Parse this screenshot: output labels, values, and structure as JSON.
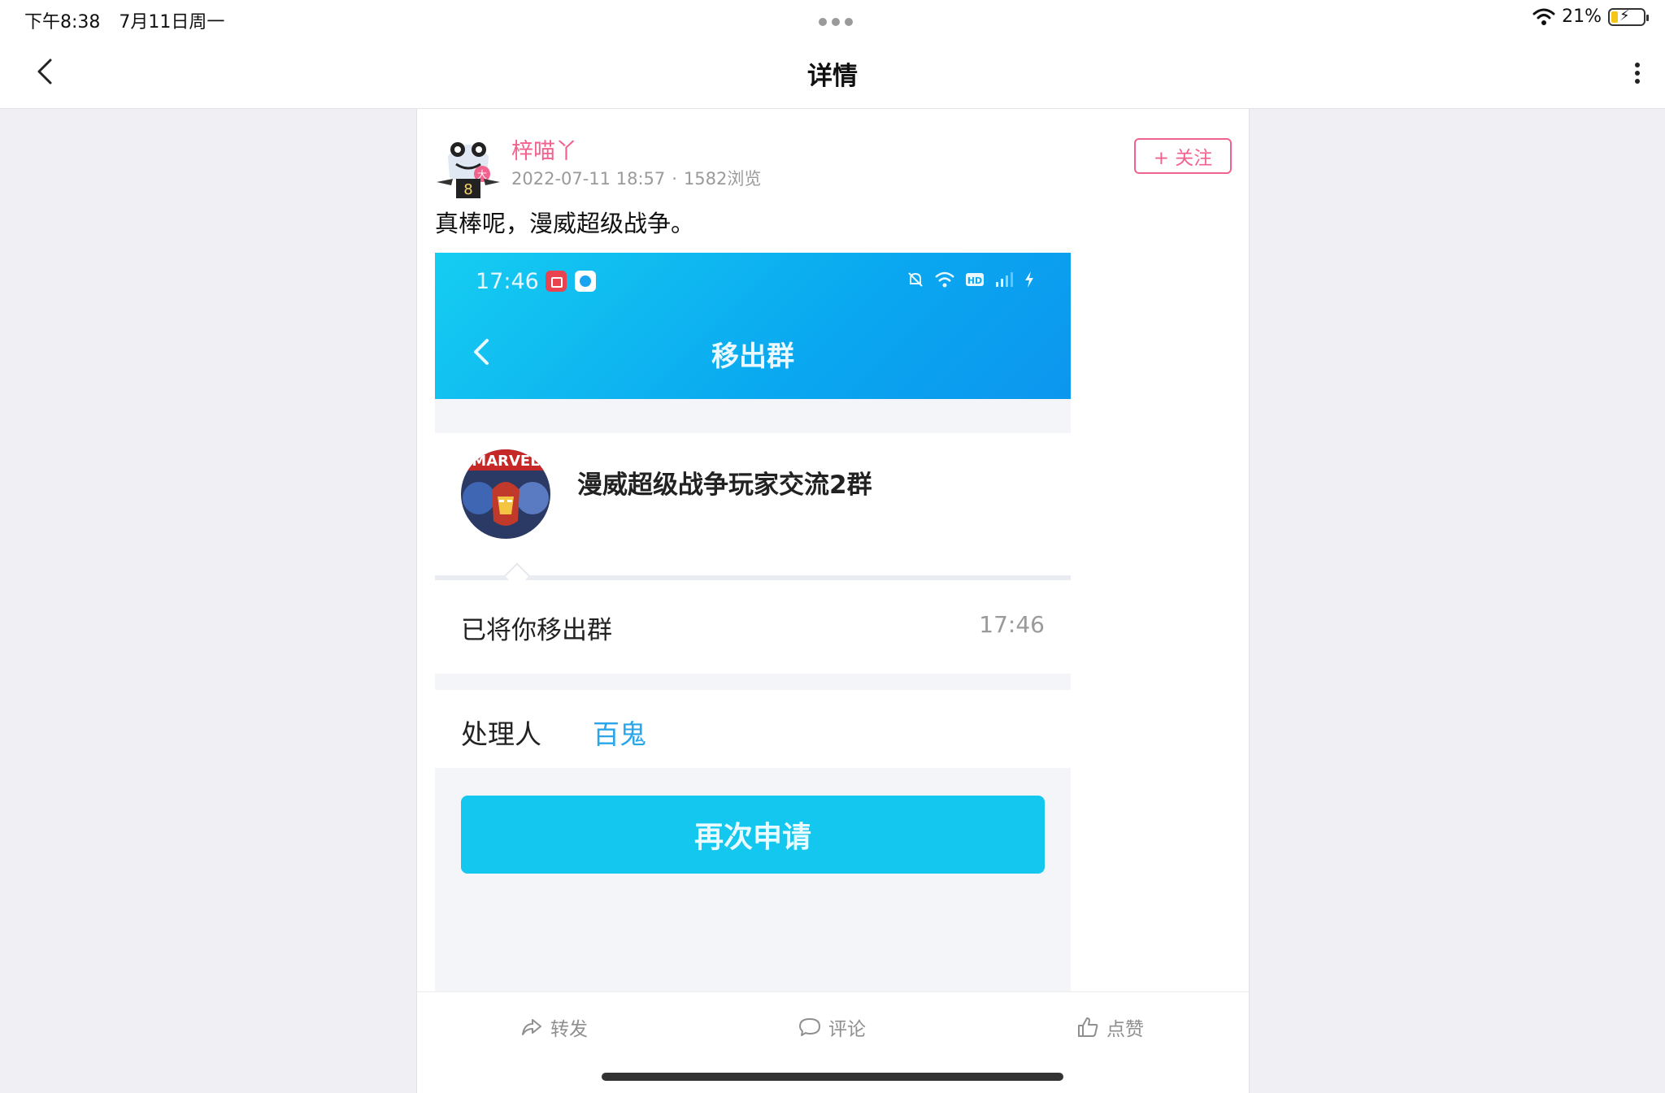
{
  "status_bar": {
    "time": "下午8:38",
    "date": "7月11日周一",
    "battery_pct": "21%",
    "battery_level": 0.21
  },
  "nav": {
    "title": "详情",
    "back_icon": "chevron-left-icon",
    "more_icon": "more-vertical-icon"
  },
  "post": {
    "author": "梓喵丫",
    "date": "2022-07-11 18:57",
    "separator": "·",
    "views": "1582浏览",
    "follow_label": "+ 关注",
    "text": "真棒呢，漫威超级战争。"
  },
  "embedded_screenshot": {
    "time": "17:46",
    "title": "移出群",
    "group_name": "漫威超级战争玩家交流2群",
    "removed_text": "已将你移出群",
    "removed_time": "17:46",
    "handler_label": "处理人",
    "handler_name": "百鬼",
    "reapply_label": "再次申请"
  },
  "actions": {
    "forward": "转发",
    "comment": "评论",
    "like": "点赞"
  },
  "colors": {
    "accent_pink": "#f2628e",
    "qq_blue": "#14c7ef",
    "link_blue": "#29a6e9"
  }
}
